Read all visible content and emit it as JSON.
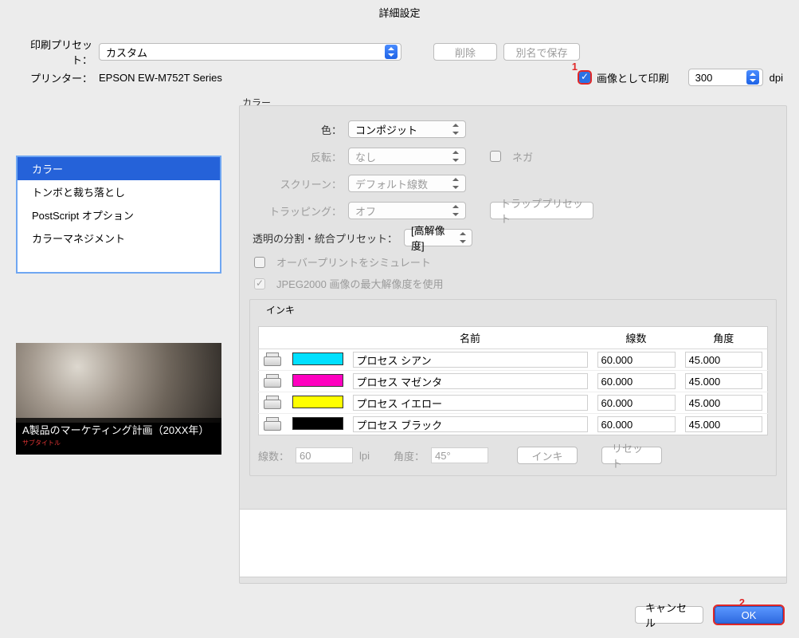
{
  "title": "詳細設定",
  "preset": {
    "label": "印刷プリセット：",
    "value": "カスタム",
    "delete": "削除",
    "saveas": "別名で保存"
  },
  "printer": {
    "label": "プリンター：",
    "name": "EPSON EW-M752T Series"
  },
  "image_print": {
    "label": "画像として印刷",
    "dpi_value": "300",
    "dpi_unit": "dpi"
  },
  "sidebar": {
    "items": [
      {
        "label": "カラー"
      },
      {
        "label": "トンボと裁ち落とし"
      },
      {
        "label": "PostScript オプション"
      },
      {
        "label": "カラーマネジメント"
      }
    ]
  },
  "color_panel": {
    "legend": "カラー",
    "color_label": "色：",
    "color_value": "コンポジット",
    "flip_label": "反転：",
    "flip_value": "なし",
    "nega_label": "ネガ",
    "screen_label": "スクリーン：",
    "screen_value": "デフォルト線数",
    "trap_label": "トラッピング：",
    "trap_value": "オフ",
    "trap_preset": "トラッププリセット",
    "flat_label": "透明の分割・統合プリセット：",
    "flat_value": "[高解像度]",
    "overprint_label": "オーバープリントをシミュレート",
    "jpeg2000_label": "JPEG2000 画像の最大解像度を使用"
  },
  "ink": {
    "legend": "インキ",
    "headers": {
      "name": "名前",
      "lines": "線数",
      "angle": "角度"
    },
    "rows": [
      {
        "color": "#00e0ff",
        "name": "プロセス シアン",
        "lines": "60.000",
        "angle": "45.000"
      },
      {
        "color": "#ff00c0",
        "name": "プロセス マゼンタ",
        "lines": "60.000",
        "angle": "45.000"
      },
      {
        "color": "#ffff00",
        "name": "プロセス イエロー",
        "lines": "60.000",
        "angle": "45.000"
      },
      {
        "color": "#000000",
        "name": "プロセス ブラック",
        "lines": "60.000",
        "angle": "45.000"
      }
    ],
    "lines_label": "線数：",
    "lines_value": "60",
    "lpi": "lpi",
    "angle_label": "角度：",
    "angle_value": "45°",
    "ink_btn": "インキ",
    "reset_btn": "リセット"
  },
  "preview": {
    "caption": "A製品のマーケティング計画（20XX年）",
    "sub": "サブタイトル"
  },
  "footer": {
    "cancel": "キャンセル",
    "ok": "OK"
  },
  "annotations": {
    "one": "1",
    "two": "2"
  }
}
